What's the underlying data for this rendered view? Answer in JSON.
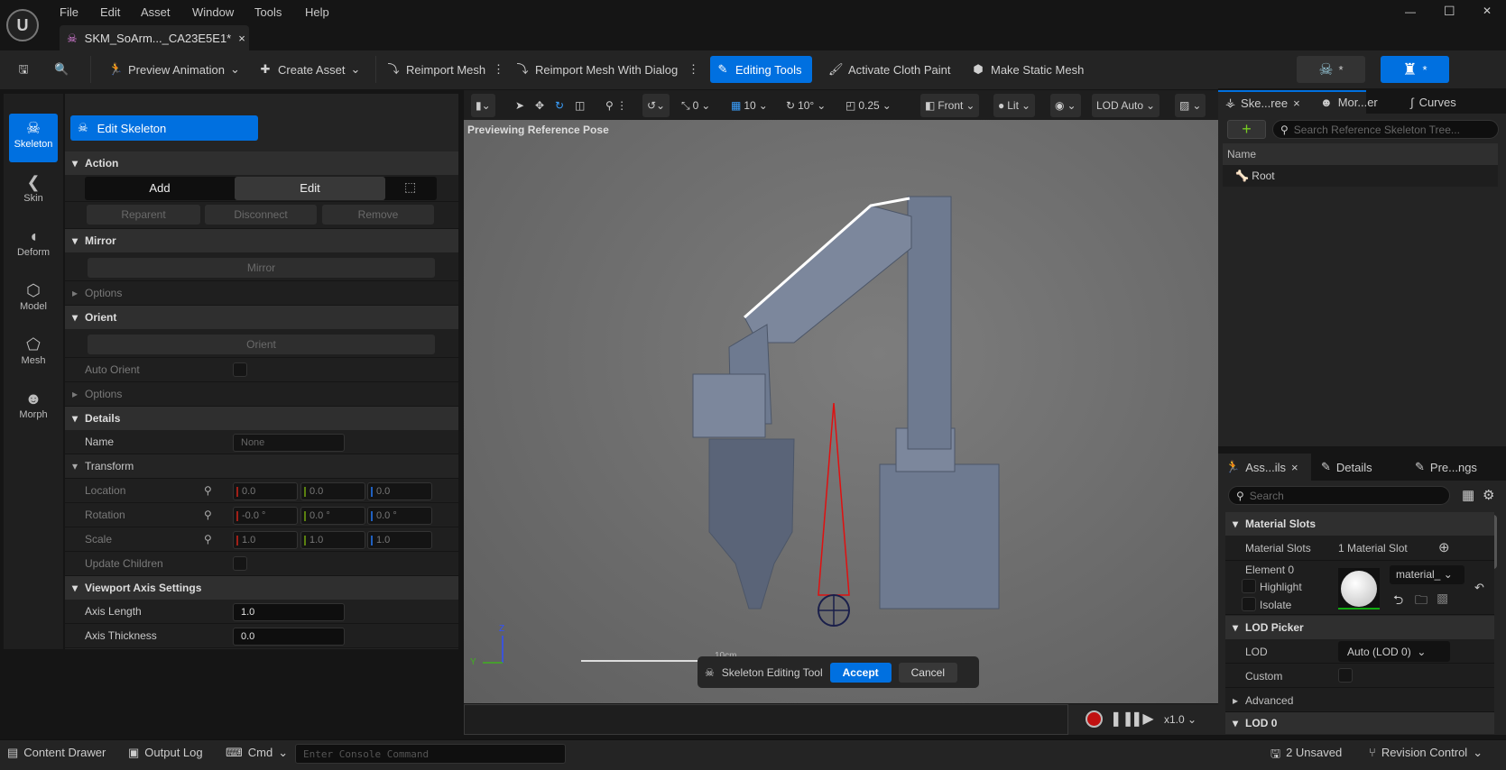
{
  "menu": [
    "File",
    "Edit",
    "Asset",
    "Window",
    "Tools",
    "Help"
  ],
  "document_tab": {
    "label": "SKM_SoArm..._CA23E5E1*",
    "close": "×"
  },
  "window_controls": {
    "minimize": "—",
    "maximize": "☐",
    "close": "✕"
  },
  "toolbar": {
    "preview_animation": "Preview Animation",
    "create_asset": "Create Asset",
    "reimport_mesh": "Reimport Mesh",
    "reimport_dialog": "Reimport Mesh With Dialog",
    "editing_tools": "Editing Tools",
    "cloth_paint": "Activate Cloth Paint",
    "static_mesh": "Make Static Mesh",
    "star": "*"
  },
  "modes": [
    {
      "label": "Skeleton",
      "icon": "☠"
    },
    {
      "label": "Skin",
      "icon": "❮"
    },
    {
      "label": "Deform",
      "icon": "◖"
    },
    {
      "label": "Model",
      "icon": "⬡"
    },
    {
      "label": "Mesh",
      "icon": "⬠"
    },
    {
      "label": "Morph",
      "icon": "☻"
    }
  ],
  "tool_panel": {
    "edit_skeleton": "Edit Skeleton",
    "action": {
      "title": "Action",
      "add": "Add",
      "edit": "Edit",
      "reparent": "Reparent",
      "disconnect": "Disconnect",
      "remove": "Remove"
    },
    "mirror": {
      "title": "Mirror",
      "button": "Mirror",
      "options": "Options"
    },
    "orient": {
      "title": "Orient",
      "button": "Orient",
      "auto_orient": "Auto Orient",
      "options": "Options"
    },
    "details": {
      "title": "Details",
      "name_label": "Name",
      "name_value": "None",
      "transform": "Transform",
      "location": "Location",
      "rotation": "Rotation",
      "scale": "Scale",
      "update_children": "Update Children",
      "location_values": [
        "0.0",
        "0.0",
        "0.0"
      ],
      "rotation_values": [
        "-0.0 °",
        "0.0 °",
        "0.0 °"
      ],
      "scale_values": [
        "1.0",
        "1.0",
        "1.0"
      ]
    },
    "axis": {
      "title": "Viewport Axis Settings",
      "length_label": "Axis Length",
      "length": "1.0",
      "thickness_label": "Axis Thickness",
      "thickness": "0.0"
    }
  },
  "viewport": {
    "snap_translate": "0",
    "grid": "10",
    "rot": "10°",
    "scale": "0.25",
    "view": "Front",
    "lit": "Lit",
    "lod": "LOD Auto",
    "overlay": "Previewing Reference Pose",
    "scale_bar": "10cm",
    "axis_z": "Z",
    "axis_y": "Y",
    "tool": {
      "label": "Skeleton Editing Tool",
      "accept": "Accept",
      "cancel": "Cancel"
    },
    "speed": "x1.0"
  },
  "colors": {
    "accent": "#0070e0",
    "bone": "#e01010"
  },
  "skeleton_tree": {
    "tabs": [
      "Ske...ree",
      "Mor...er",
      "Curves"
    ],
    "search_placeholder": "Search Reference Skeleton Tree...",
    "header": "Name",
    "root": "Root"
  },
  "details_panel": {
    "tabs": [
      "Ass...ils",
      "Details",
      "Pre...ngs"
    ],
    "search_placeholder": "Search",
    "material_slots": "Material Slots",
    "slots_label": "Material Slots",
    "slots_value": "1 Material Slot",
    "element": "Element 0",
    "highlight": "Highlight",
    "isolate": "Isolate",
    "material": "material_",
    "lod_picker": "LOD Picker",
    "lod_label": "LOD",
    "lod_value": "Auto (LOD 0)",
    "custom": "Custom",
    "advanced": "Advanced",
    "lod0": "LOD 0"
  },
  "status": {
    "content_drawer": "Content Drawer",
    "output_log": "Output Log",
    "cmd": "Cmd",
    "console_placeholder": "Enter Console Command",
    "unsaved": "2 Unsaved",
    "revision": "Revision Control"
  }
}
